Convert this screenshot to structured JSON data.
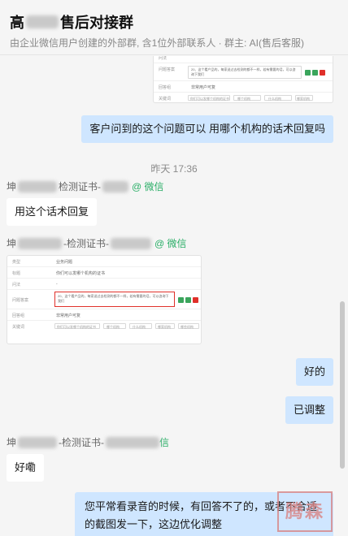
{
  "header": {
    "title_prefix": "高",
    "title_suffix": "售后对接群",
    "subtitle": "由企业微信用户创建的外部群, 含1位外部联系人 · 群主: AI(售后客服)"
  },
  "messages": {
    "m1": "客户问到的这个问题可以 用哪个机构的话术回复吗",
    "time": "昨天 17:36",
    "sender1_prefix": "坤",
    "sender1_mid": "检测证书-",
    "sender1_tag": "@ 微信",
    "m2": "用这个话术回复",
    "sender2_prefix": "坤",
    "sender2_mid": "-检测证书-",
    "sender2_tag": "@ 微信",
    "m3": "好的",
    "m4": "已调整",
    "sender3_prefix": "坤",
    "sender3_mid": "-检测证书-",
    "sender3_tag": "信",
    "m5": "好嘞",
    "m6": "您平常看录音的时候，有回答不了的，或者不合适的截图发一下，这边优化调整"
  },
  "shot_top": {
    "r1k": "问法",
    "r2k": "问题答案",
    "r2v": "20、这个看产品的，每家送过去检测的都不一样，若有需要的话，可以咨询下我们",
    "r3k": "回答组",
    "r3v": "非常用户可复",
    "r4k": "关键词",
    "chips": [
      "你们可以发哪个机构的证书",
      "哪个机构",
      "什么机构",
      "哪家机构",
      "哪些机构"
    ]
  },
  "shot_bottom": {
    "r1k": "类型",
    "r1v": "业务问题",
    "r2k": "标题",
    "r2v": "你们可以发哪个机构的证书",
    "r3k": "问法",
    "r3v": "-",
    "r4k": "问题答案",
    "r4v": "20、这个看产品的，每家送过去检测的都不一样，若有需要的话，可以咨询下我们",
    "r5k": "回答组",
    "r5v": "非常用户可复",
    "r6k": "关键词",
    "chips": [
      "你们可以发哪个机构的证书",
      "哪个机构",
      "什么机构",
      "哪家机构",
      "哪些机构"
    ]
  },
  "watermark": "腾森"
}
